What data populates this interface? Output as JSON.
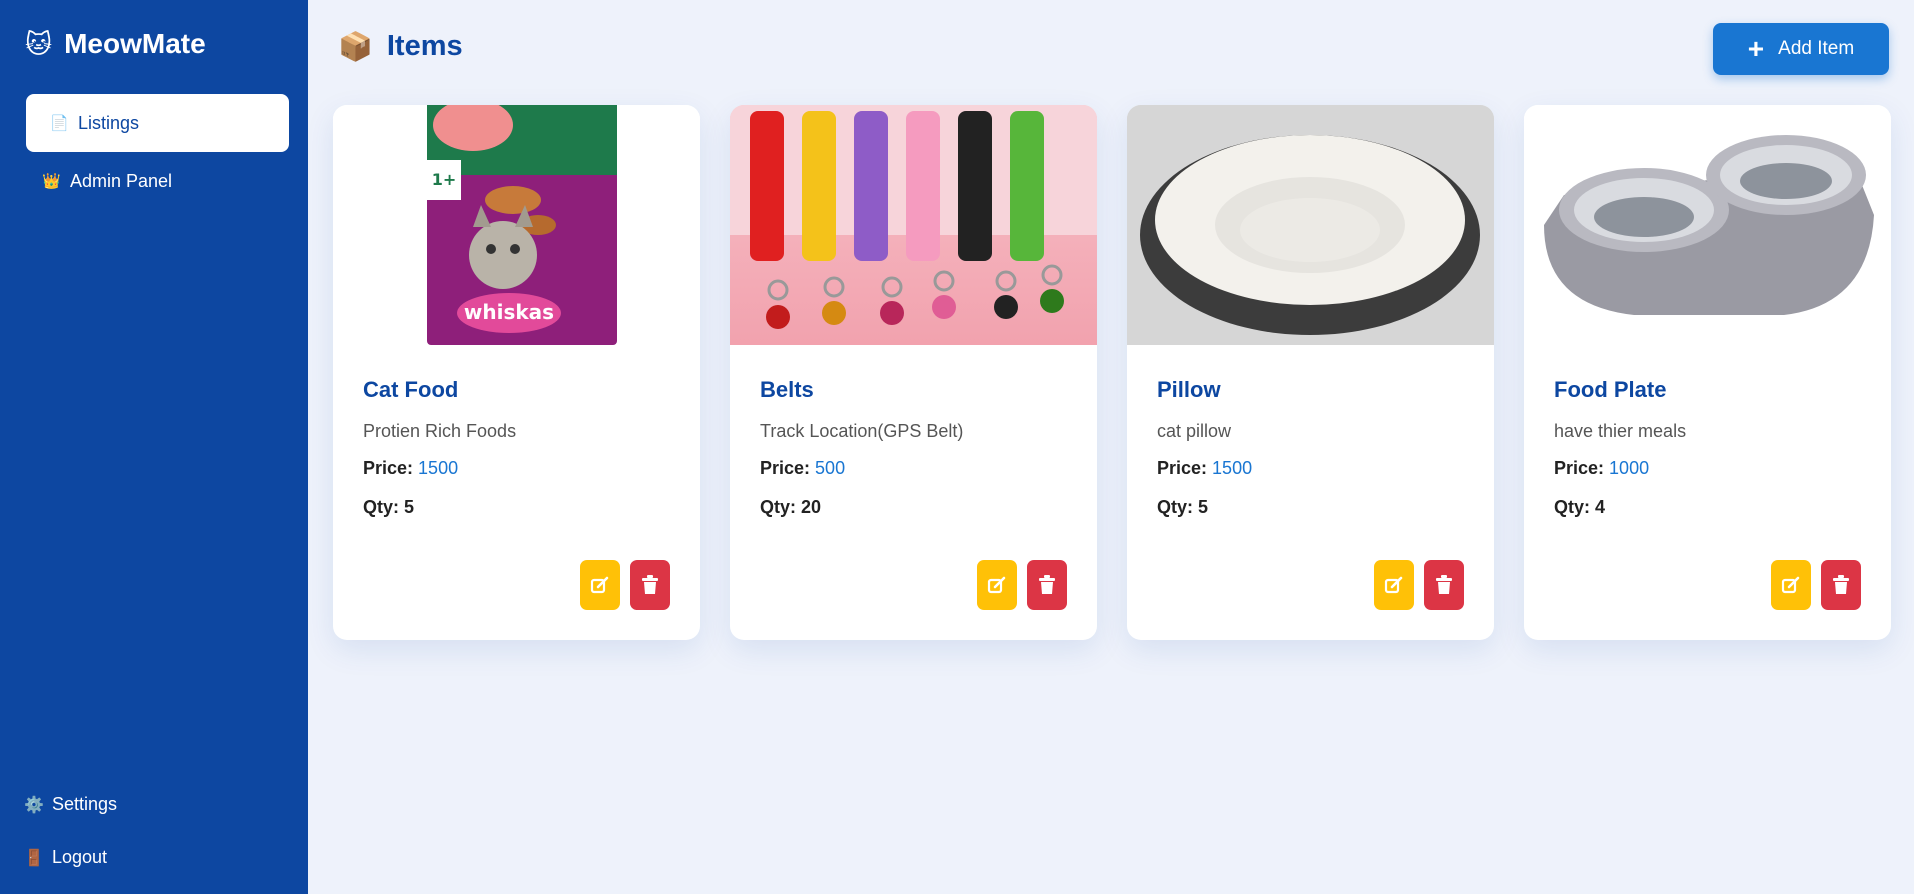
{
  "app": {
    "name": "MeowMate",
    "brand_icon": "cat-face-icon"
  },
  "sidebar": {
    "items": [
      {
        "label": "Listings",
        "icon": "document-icon",
        "active": true
      },
      {
        "label": "Admin Panel",
        "icon": "crown-icon",
        "active": false
      }
    ],
    "bottom": [
      {
        "label": "Settings",
        "icon": "gear-icon"
      },
      {
        "label": "Logout",
        "icon": "door-icon"
      }
    ]
  },
  "header": {
    "title": "Items",
    "icon": "package-icon",
    "add_label": "Add Item"
  },
  "price_label": "Price:",
  "qty_label": "Qty:",
  "items": [
    {
      "name": "Cat Food",
      "description": "Protien Rich Foods",
      "price": "1500",
      "qty": "Qty: 5",
      "image": "cat-food-bag"
    },
    {
      "name": "Belts",
      "description": "Track Location(GPS Belt)",
      "price": "500",
      "qty": "Qty: 20",
      "image": "cat-collars"
    },
    {
      "name": "Pillow",
      "description": "cat pillow",
      "price": "1500",
      "qty": "Qty: 5",
      "image": "cat-bed"
    },
    {
      "name": "Food Plate",
      "description": "have thier meals",
      "price": "1000",
      "qty": "Qty: 4",
      "image": "double-bowl"
    }
  ],
  "colors": {
    "sidebar": "#0d47a1",
    "accent": "#1976d2",
    "edit": "#ffc107",
    "delete": "#dc3545"
  }
}
